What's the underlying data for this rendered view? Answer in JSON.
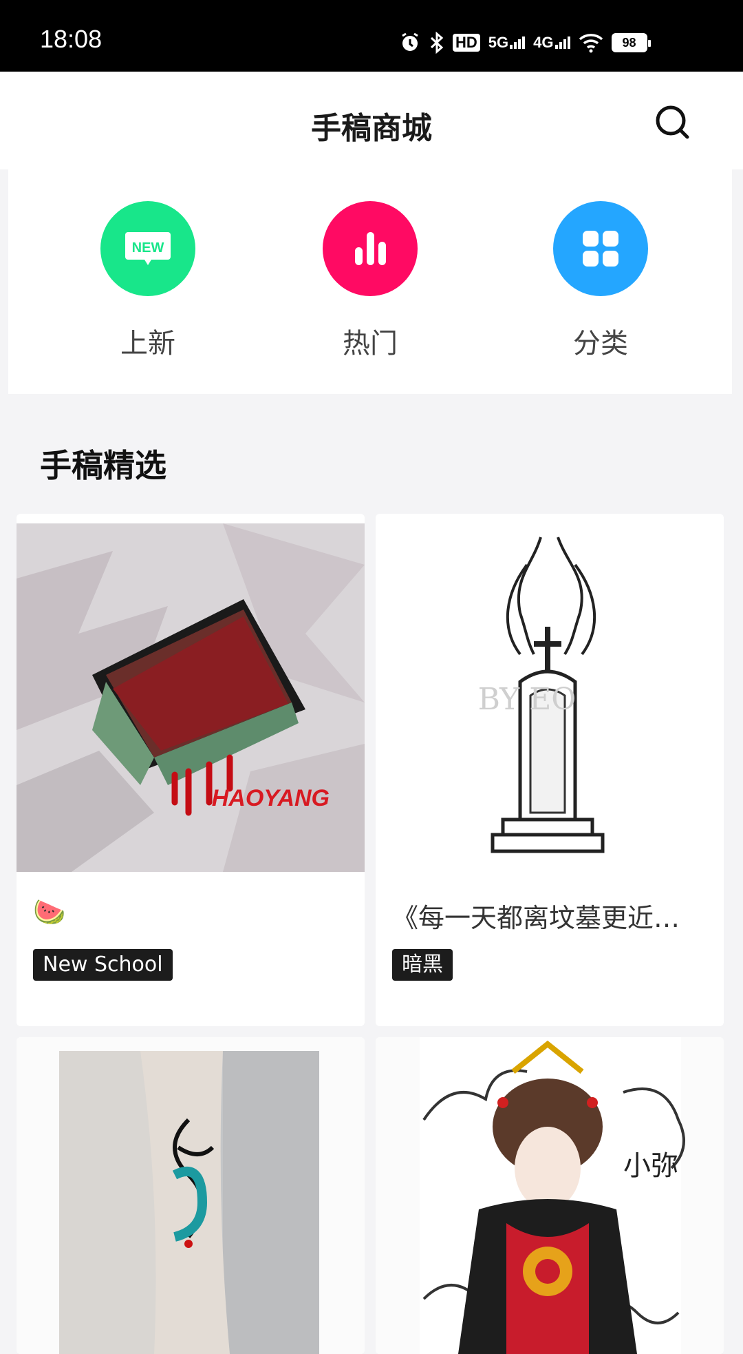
{
  "status_bar": {
    "time": "18:08",
    "hd_label": "HD",
    "net5g": "5G",
    "net4g": "4G",
    "battery": "98"
  },
  "header": {
    "title": "手稿商城",
    "search_icon": "search-icon"
  },
  "categories": [
    {
      "label": "上新",
      "icon": "new-icon",
      "color": "#18e68a",
      "badge": "NEW"
    },
    {
      "label": "热门",
      "icon": "bar-chart-icon",
      "color": "#ff0a63"
    },
    {
      "label": "分类",
      "icon": "grid-icon",
      "color": "#24a6ff"
    }
  ],
  "section": {
    "title": "手稿精选"
  },
  "products": [
    {
      "title": "🍉",
      "tag": "New School",
      "image": "watermelon-slice-illustration",
      "image_text": "HAOYANG"
    },
    {
      "title": "《每一天都离坟墓更近…",
      "tag": "暗黑",
      "image": "tombstone-illustration",
      "image_text": "BY EO"
    },
    {
      "title": "",
      "tag": "",
      "image": "forearm-ink-tattoo-photo",
      "image_text": ""
    },
    {
      "title": "",
      "tag": "",
      "image": "geisha-illustration",
      "image_text": "小弥"
    }
  ]
}
